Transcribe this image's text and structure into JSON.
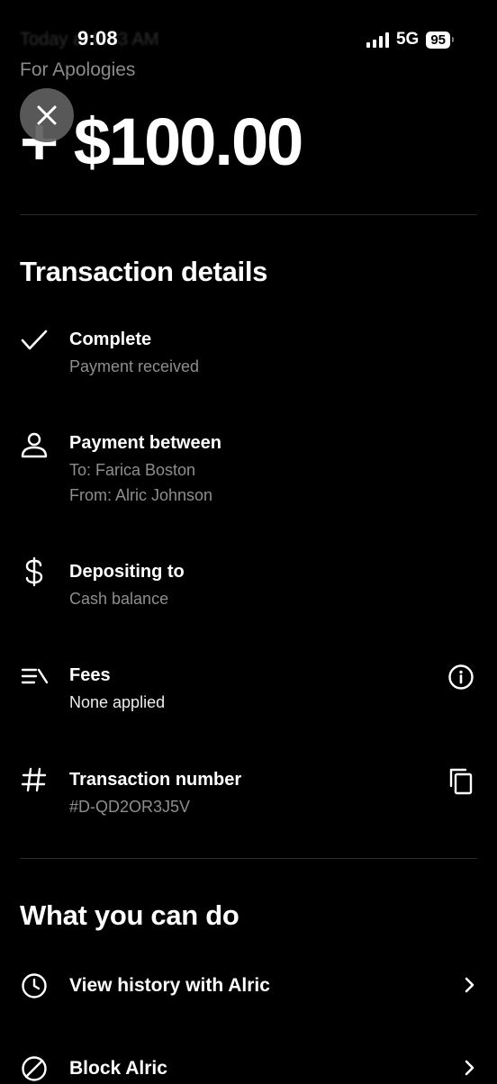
{
  "status_bar": {
    "time": "9:08",
    "network": "5G",
    "battery": "95"
  },
  "header": {
    "faded_text": "Today at 8:53 AM",
    "subtitle": "For Apologies",
    "amount": "+ $100.00"
  },
  "details": {
    "title": "Transaction details",
    "items": [
      {
        "icon": "check-icon",
        "title": "Complete",
        "lines": [
          "Payment received"
        ]
      },
      {
        "icon": "person-icon",
        "title": "Payment between",
        "lines": [
          "To: Farica Boston",
          "From: Alric Johnson"
        ]
      },
      {
        "icon": "dollar-icon",
        "title": "Depositing to",
        "lines": [
          "Cash balance"
        ]
      },
      {
        "icon": "fees-icon",
        "title": "Fees",
        "lines": [
          "None applied"
        ],
        "right_icon": "info-icon"
      },
      {
        "icon": "hash-icon",
        "title": "Transaction number",
        "lines": [
          "#D-QD2OR3J5V"
        ],
        "right_icon": "copy-icon"
      }
    ]
  },
  "actions": {
    "title": "What you can do",
    "items": [
      {
        "icon": "clock-icon",
        "label": "View history with Alric"
      },
      {
        "icon": "block-icon",
        "label": "Block Alric"
      }
    ]
  }
}
